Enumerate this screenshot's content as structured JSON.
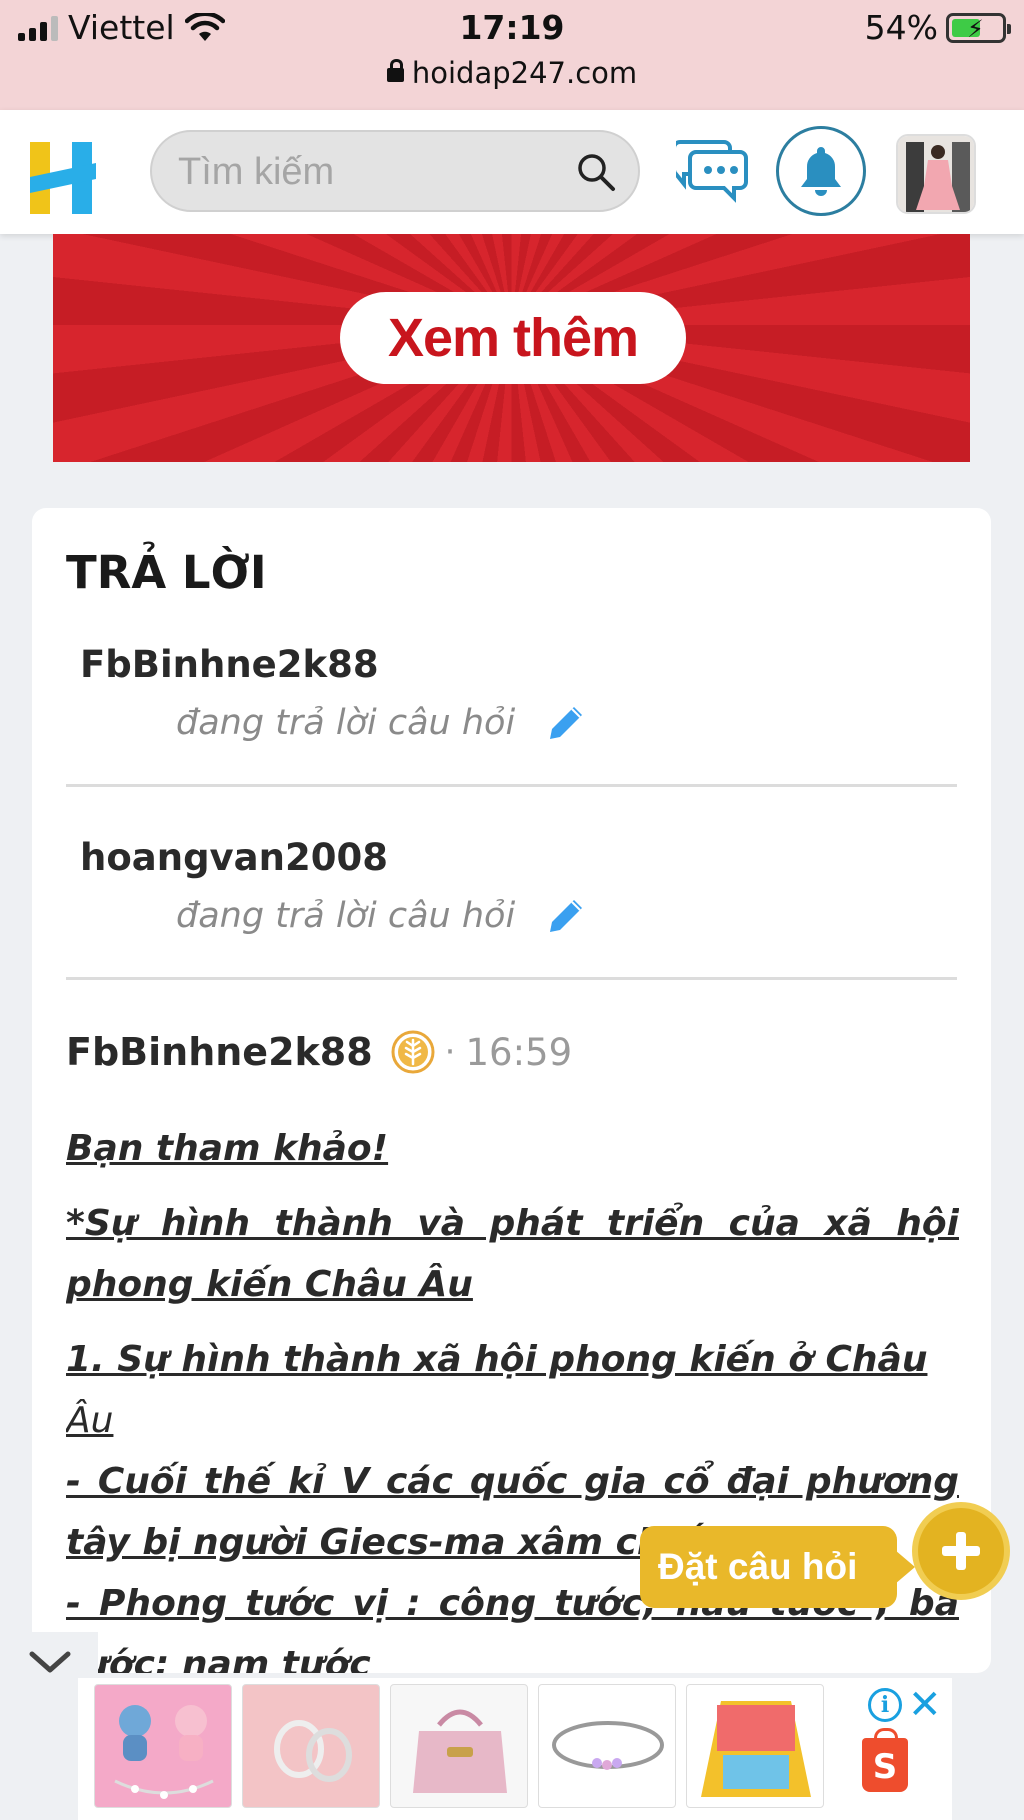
{
  "status_bar": {
    "carrier": "Viettel",
    "time": "17:19",
    "battery": "54%",
    "url": "hoidap247.com"
  },
  "header": {
    "search_placeholder": "Tìm kiếm"
  },
  "banner": {
    "button_label": "Xem thêm"
  },
  "answers": {
    "title": "TRẢ LỜI",
    "typing_users": [
      {
        "name": "FbBinhne2k88",
        "status": "đang trả lời câu hỏi"
      },
      {
        "name": "hoangvan2008",
        "status": "đang trả lời câu hỏi"
      }
    ],
    "answer": {
      "author": "FbBinhne2k88",
      "dot": "·",
      "time": "16:59",
      "paragraphs": [
        "Bạn tham khảo!",
        "*Sự hình thành và phát triển của xã hội phong kiến Châu Âu",
        "1. Sự hình thành xã hội phong kiến ở Châu",
        "Âu",
        "- Cuối thế kỉ V các quốc gia cổ đại phương tây bị người Giecs-ma xâm chiếm",
        "- Phong tước vị : công tước; hầu tước ; bá tước; nam tước"
      ]
    }
  },
  "fab": {
    "label": "Đặt câu hỏi"
  },
  "colors": {
    "brand_yellow": "#e9b82a",
    "brand_blue": "#29aee8",
    "banner_red": "#d7252d",
    "pencil_blue": "#3aa0f0"
  }
}
